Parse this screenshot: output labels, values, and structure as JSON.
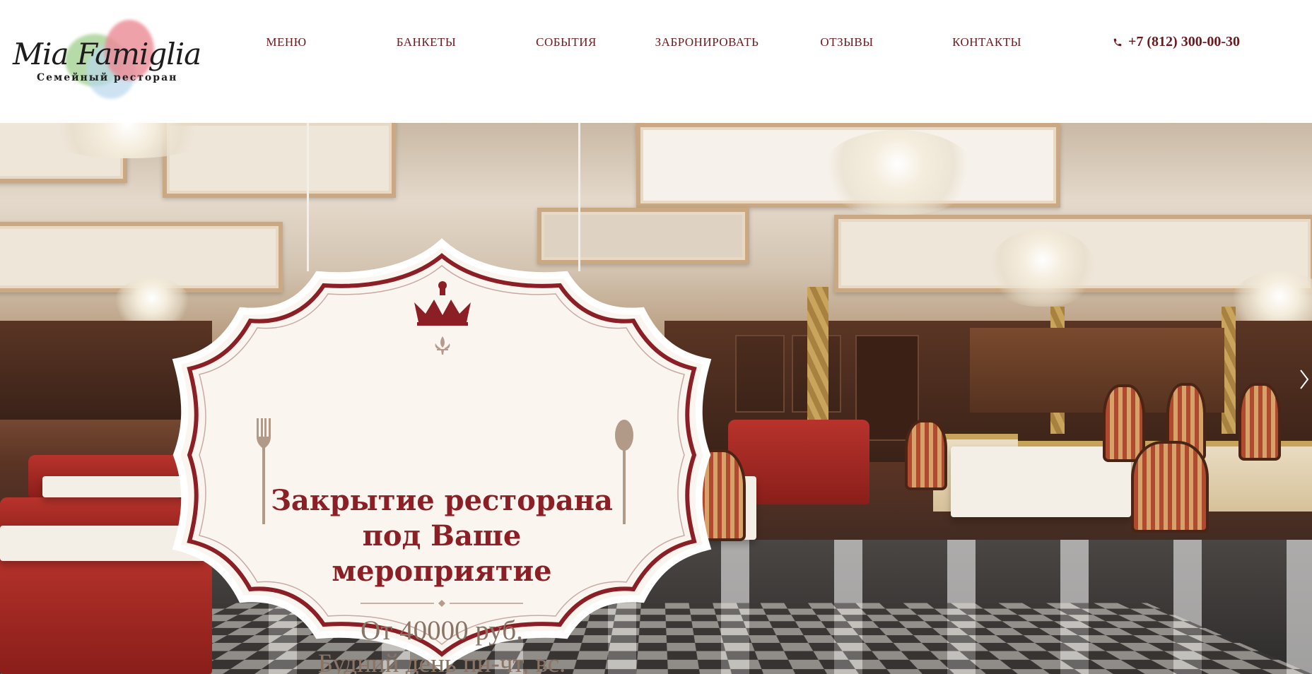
{
  "brand": {
    "name": "Mia Famiglia",
    "tagline": "Семейный ресторан"
  },
  "nav": {
    "items": [
      {
        "label": "МЕНЮ"
      },
      {
        "label": "БАНКЕТЫ"
      },
      {
        "label": "СОБЫТИЯ"
      },
      {
        "label": "ЗАБРОНИРОВАТЬ"
      },
      {
        "label": "ОТЗЫВЫ"
      },
      {
        "label": "КОНТАКТЫ"
      }
    ],
    "phone": "+7 (812) 300-00-30",
    "phone_icon": "phone-icon"
  },
  "promo": {
    "title_line1": "Закрытие ресторана",
    "title_line2": "под Ваше",
    "title_line3": "мероприятие",
    "price": "От 40000 руб.",
    "days": "Будний день пн-чт, вс.",
    "icons": [
      "crown-icon",
      "fleur-de-lis-icon",
      "fork-icon",
      "spoon-icon"
    ]
  },
  "slider": {
    "next_icon": "chevron-right-icon"
  },
  "colors": {
    "brand": "#6b1a1e",
    "accent": "#8c1f25",
    "muted": "#8a7466",
    "badge_bg": "#faf6ef"
  }
}
